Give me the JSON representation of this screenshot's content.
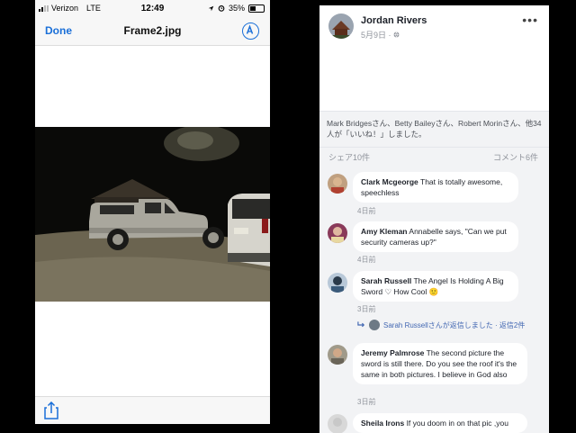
{
  "status_bar": {
    "carrier": "Verizon",
    "network": "LTE",
    "time": "12:49",
    "battery": "35%",
    "battery_fraction": 0.35
  },
  "nav": {
    "done_label": "Done",
    "title": "Frame2.jpg"
  },
  "post": {
    "author": "Jordan Rivers",
    "date": "5月9日 · ",
    "likes_text": "Mark Bridgesさん、Betty Baileyさん、Robert Morinさん、他34人が「いいね！」しました。",
    "shares": "シェア10件",
    "comments_count": "コメント6件"
  },
  "comments": [
    {
      "name": "Clark Mcgeorge",
      "text": "That is totally awesome, speechless",
      "time": "4日前"
    },
    {
      "name": "Amy Kleman",
      "text": "Annabelle says, \"Can we put security cameras up?\"",
      "time": "4日前"
    },
    {
      "name": "Sarah Russell",
      "text": "The Angel Is Holding A Big Sword ♡ How Cool 🙂",
      "time": "3日前",
      "reply": "Sarah Russellさんが返信しました · 返信2件"
    },
    {
      "name": "Jeremy Palmrose",
      "text": "The second picture the sword is still there. Do you see the roof it's the same in both pictures. I believe in God also",
      "time": "3日前"
    },
    {
      "name": "Sheila Irons",
      "text": "If you doom in on that pic ,you"
    }
  ],
  "colors": {
    "ios_blue": "#1a6fd8",
    "fb_link": "#4267b2",
    "fb_bg": "#f2f3f5"
  }
}
